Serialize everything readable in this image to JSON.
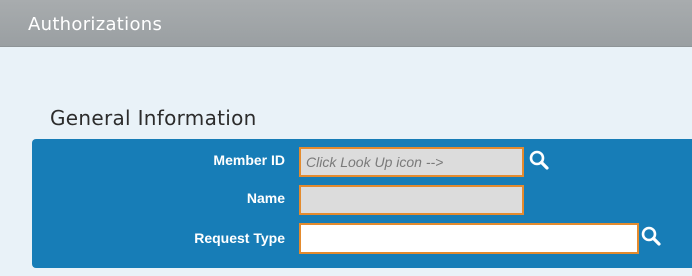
{
  "header": {
    "title": "Authorizations"
  },
  "general_information": {
    "title": "General Information",
    "fields": {
      "member_id": {
        "label": "Member ID",
        "value": "",
        "placeholder": "Click Look Up icon -->"
      },
      "name": {
        "label": "Name",
        "value": ""
      },
      "request_type": {
        "label": "Request Type",
        "value": ""
      }
    }
  },
  "icons": {
    "member_lookup": "search-icon",
    "request_type_lookup": "search-icon"
  },
  "colors": {
    "header_bg": "#9fa4a6",
    "page_bg": "#e9f2f8",
    "panel_bg": "#177db7",
    "field_border": "#e48b2e",
    "readonly_field_bg": "#dcdcdc"
  }
}
